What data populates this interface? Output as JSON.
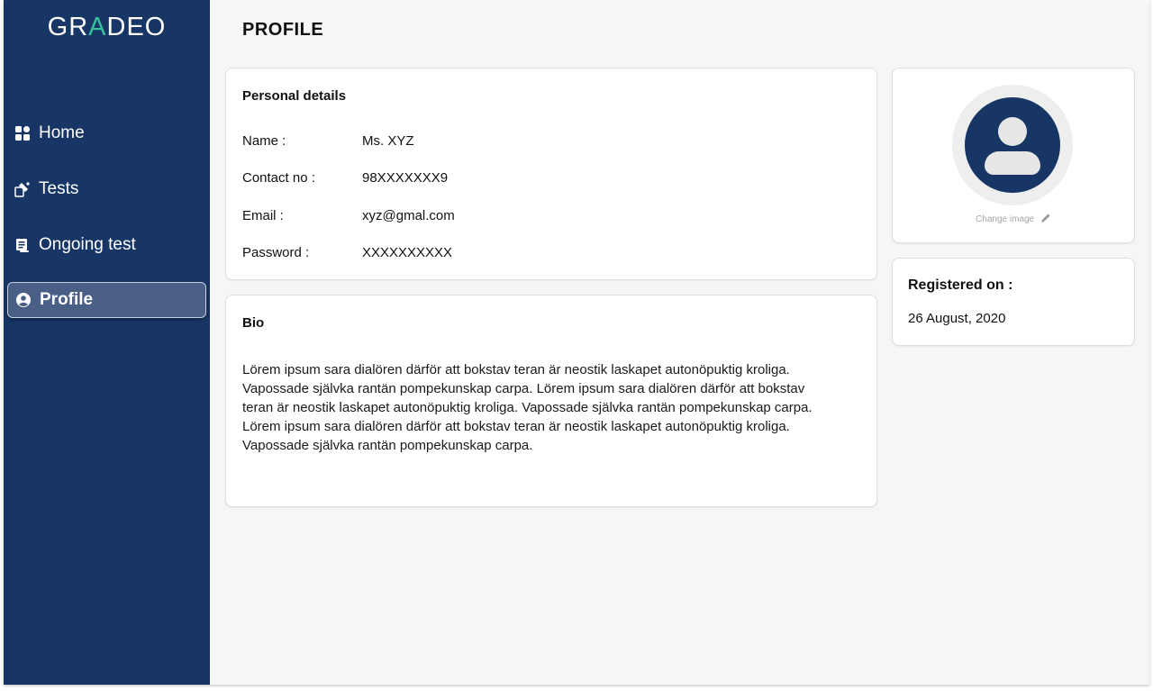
{
  "app": {
    "logo_left": "GR",
    "logo_mark": "A",
    "logo_right": "DEO"
  },
  "sidebar": {
    "items": [
      {
        "label": "Home",
        "icon": "home-grid-icon"
      },
      {
        "label": "Tests",
        "icon": "tests-icon"
      },
      {
        "label": "Ongoing test",
        "icon": "ongoing-test-icon"
      },
      {
        "label": "Profile",
        "icon": "profile-icon",
        "active": true
      }
    ]
  },
  "page": {
    "title": "PROFILE"
  },
  "personal_details": {
    "title": "Personal details",
    "fields": [
      {
        "label": "Name :",
        "value": "Ms. XYZ"
      },
      {
        "label": "Contact no :",
        "value": "98XXXXXXX9"
      },
      {
        "label": "Email :",
        "value": "xyz@gmal.com"
      },
      {
        "label": "Password :",
        "value": "XXXXXXXXXX"
      }
    ]
  },
  "bio": {
    "title": "Bio",
    "text": "Lörem ipsum sara dialören därför att bokstav teran är neostik laskapet autonöpuktig kroliga. Vapossade självka rantän pompekunskap carpa. Lörem ipsum sara dialören därför att bokstav teran är neostik laskapet autonöpuktig kroliga. Vapossade självka rantän pompekunskap carpa. Lörem ipsum sara dialören därför att bokstav teran är neostik laskapet autonöpuktig kroliga. Vapossade självka rantän pompekunskap carpa."
  },
  "avatar_card": {
    "change_image_label": "Change image",
    "icon": "pencil-icon"
  },
  "registration": {
    "title": "Registered on :",
    "date": "26 August, 2020"
  },
  "colors": {
    "sidebar": "#173666",
    "accent": "#35c29a",
    "background": "#f7f6f4"
  }
}
